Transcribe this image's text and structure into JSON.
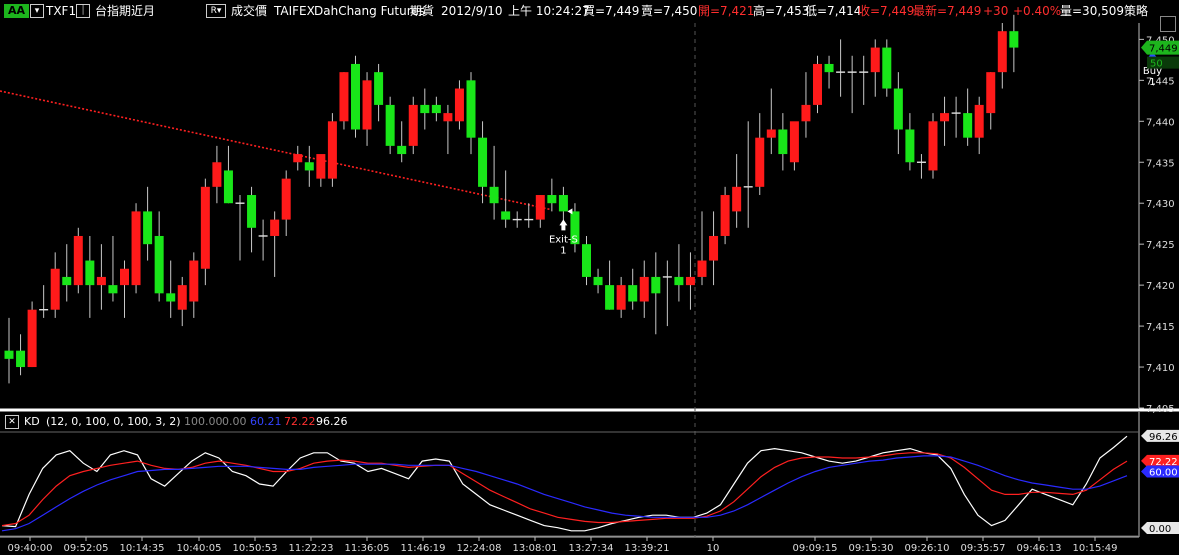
{
  "header": {
    "aa_label": "AA",
    "symbol": "TXF1",
    "symbol_name": "台指期近月",
    "mode_label": "成交價",
    "exchange": "TAIFEX",
    "broker": "DahChang Futures",
    "market": "期貨",
    "date": "2012/9/10",
    "time": "上午 10:24:27",
    "bid": "買=7,449",
    "ask": "賣=7,450",
    "open": "開=7,421",
    "high": "高=7,453",
    "low": "低=7,414",
    "close": "收=7,449",
    "last": "最新=7,449",
    "change": "+30",
    "change_pct": "+0.40%",
    "volume": "量=30,509",
    "strategy": "策略"
  },
  "colors": {
    "up": "#ff1a1a",
    "down": "#19e619",
    "k_line": "#ffffff",
    "d_line_red": "#ff2020",
    "d_line_blue": "#2a2aff",
    "trend_line": "#ff2020",
    "accent_green": "#1db51d"
  },
  "kd_panel": {
    "label": "KD",
    "params": "(12, 0, 100, 0, 100, 3, 2)",
    "v1": "100.00",
    "v2": "0.00",
    "v3": "60.21",
    "v4": "72.22",
    "v5": "96.26",
    "axis_labels": [
      "96.26",
      "72.22",
      "60.00",
      "0.00"
    ]
  },
  "chart_data": [
    {
      "type": "candlestick",
      "ylim": [
        7405,
        7452
      ],
      "y_ticks": [
        "7,450",
        "7,445",
        "7,440",
        "7,435",
        "7,430",
        "7,425",
        "7,420",
        "7,415",
        "7,410",
        "7,405"
      ],
      "last_price_label": "7,449",
      "last_volume_label": "50",
      "x_tick_labels": [
        "09:40:00",
        "09:52:05",
        "10:14:35",
        "10:40:05",
        "10:50:53",
        "11:22:23",
        "11:36:05",
        "11:46:19",
        "12:24:08",
        "13:08:01",
        "13:27:34",
        "13:39:21",
        "10",
        "09:09:15",
        "09:15:30",
        "09:26:10",
        "09:35:57",
        "09:46:13",
        "10:15:49"
      ],
      "trend_line": {
        "from": [
          0,
          7443.7
        ],
        "to": [
          47,
          7429.2
        ]
      },
      "signals": [
        {
          "label": "Exit-S",
          "qty": "1",
          "bar": 48,
          "price": 7429
        },
        {
          "label": "Buy",
          "qty": "1",
          "bar": 99,
          "price": 7447
        }
      ],
      "bars": [
        {
          "o": 7412,
          "h": 7416,
          "l": 7408,
          "c": 7411
        },
        {
          "o": 7412,
          "h": 7414,
          "l": 7409,
          "c": 7410
        },
        {
          "o": 7410,
          "h": 7418,
          "l": 7410,
          "c": 7417
        },
        {
          "o": 7417,
          "h": 7420,
          "l": 7416,
          "c": 7417
        },
        {
          "o": 7417,
          "h": 7424,
          "l": 7416,
          "c": 7422
        },
        {
          "o": 7421,
          "h": 7425,
          "l": 7418,
          "c": 7420
        },
        {
          "o": 7420,
          "h": 7427,
          "l": 7419,
          "c": 7426
        },
        {
          "o": 7423,
          "h": 7426,
          "l": 7416,
          "c": 7420
        },
        {
          "o": 7420,
          "h": 7425,
          "l": 7417,
          "c": 7421
        },
        {
          "o": 7420,
          "h": 7426,
          "l": 7418,
          "c": 7419
        },
        {
          "o": 7420,
          "h": 7423,
          "l": 7416,
          "c": 7422
        },
        {
          "o": 7420,
          "h": 7430,
          "l": 7419,
          "c": 7429
        },
        {
          "o": 7429,
          "h": 7432,
          "l": 7423,
          "c": 7425
        },
        {
          "o": 7426,
          "h": 7429,
          "l": 7418,
          "c": 7419
        },
        {
          "o": 7419,
          "h": 7423,
          "l": 7416,
          "c": 7418
        },
        {
          "o": 7417,
          "h": 7421,
          "l": 7415,
          "c": 7420
        },
        {
          "o": 7418,
          "h": 7424,
          "l": 7416,
          "c": 7423
        },
        {
          "o": 7422,
          "h": 7433,
          "l": 7420,
          "c": 7432
        },
        {
          "o": 7432,
          "h": 7437,
          "l": 7430,
          "c": 7435
        },
        {
          "o": 7434,
          "h": 7437,
          "l": 7430,
          "c": 7430
        },
        {
          "o": 7430,
          "h": 7431,
          "l": 7423,
          "c": 7430
        },
        {
          "o": 7431,
          "h": 7432,
          "l": 7424,
          "c": 7427
        },
        {
          "o": 7426,
          "h": 7428,
          "l": 7423,
          "c": 7426
        },
        {
          "o": 7426,
          "h": 7429,
          "l": 7421,
          "c": 7428
        },
        {
          "o": 7428,
          "h": 7434,
          "l": 7426,
          "c": 7433
        },
        {
          "o": 7435,
          "h": 7437,
          "l": 7434,
          "c": 7436
        },
        {
          "o": 7435,
          "h": 7437,
          "l": 7432,
          "c": 7434
        },
        {
          "o": 7433,
          "h": 7435,
          "l": 7432,
          "c": 7436
        },
        {
          "o": 7433,
          "h": 7441,
          "l": 7432,
          "c": 7440
        },
        {
          "o": 7440,
          "h": 7446,
          "l": 7439,
          "c": 7446
        },
        {
          "o": 7447,
          "h": 7448,
          "l": 7438,
          "c": 7439
        },
        {
          "o": 7439,
          "h": 7446,
          "l": 7437,
          "c": 7445
        },
        {
          "o": 7446,
          "h": 7447,
          "l": 7440,
          "c": 7442
        },
        {
          "o": 7442,
          "h": 7443,
          "l": 7436,
          "c": 7437
        },
        {
          "o": 7437,
          "h": 7440,
          "l": 7435,
          "c": 7436
        },
        {
          "o": 7437,
          "h": 7443,
          "l": 7436,
          "c": 7442
        },
        {
          "o": 7442,
          "h": 7444,
          "l": 7439,
          "c": 7441
        },
        {
          "o": 7442,
          "h": 7443,
          "l": 7440,
          "c": 7441
        },
        {
          "o": 7440,
          "h": 7442,
          "l": 7436,
          "c": 7441
        },
        {
          "o": 7440,
          "h": 7445,
          "l": 7439,
          "c": 7444
        },
        {
          "o": 7445,
          "h": 7446,
          "l": 7436,
          "c": 7438
        },
        {
          "o": 7438,
          "h": 7440,
          "l": 7430,
          "c": 7432
        },
        {
          "o": 7432,
          "h": 7437,
          "l": 7428,
          "c": 7430
        },
        {
          "o": 7429,
          "h": 7434,
          "l": 7427,
          "c": 7428
        },
        {
          "o": 7428,
          "h": 7429,
          "l": 7427,
          "c": 7428
        },
        {
          "o": 7428,
          "h": 7430,
          "l": 7427,
          "c": 7428
        },
        {
          "o": 7428,
          "h": 7431,
          "l": 7427,
          "c": 7431
        },
        {
          "o": 7431,
          "h": 7433,
          "l": 7429,
          "c": 7430
        },
        {
          "o": 7431,
          "h": 7432,
          "l": 7427,
          "c": 7429
        },
        {
          "o": 7429,
          "h": 7430,
          "l": 7424,
          "c": 7425
        },
        {
          "o": 7425,
          "h": 7426,
          "l": 7420,
          "c": 7421
        },
        {
          "o": 7421,
          "h": 7422,
          "l": 7419,
          "c": 7420
        },
        {
          "o": 7420,
          "h": 7423,
          "l": 7417,
          "c": 7417
        },
        {
          "o": 7417,
          "h": 7421,
          "l": 7416,
          "c": 7420
        },
        {
          "o": 7420,
          "h": 7422,
          "l": 7417,
          "c": 7418
        },
        {
          "o": 7418,
          "h": 7423,
          "l": 7416,
          "c": 7421
        },
        {
          "o": 7421,
          "h": 7424,
          "l": 7414,
          "c": 7419
        },
        {
          "o": 7421,
          "h": 7423,
          "l": 7415,
          "c": 7421
        },
        {
          "o": 7421,
          "h": 7425,
          "l": 7418,
          "c": 7420
        },
        {
          "o": 7420,
          "h": 7424,
          "l": 7417,
          "c": 7421
        },
        {
          "o": 7421,
          "h": 7429,
          "l": 7420,
          "c": 7423
        },
        {
          "o": 7423,
          "h": 7429,
          "l": 7420,
          "c": 7426
        },
        {
          "o": 7426,
          "h": 7432,
          "l": 7425,
          "c": 7431
        },
        {
          "o": 7429,
          "h": 7436,
          "l": 7427,
          "c": 7432
        },
        {
          "o": 7432,
          "h": 7440,
          "l": 7427,
          "c": 7432
        },
        {
          "o": 7432,
          "h": 7441,
          "l": 7431,
          "c": 7438
        },
        {
          "o": 7438,
          "h": 7444,
          "l": 7436,
          "c": 7439
        },
        {
          "o": 7439,
          "h": 7441,
          "l": 7434,
          "c": 7436
        },
        {
          "o": 7435,
          "h": 7439,
          "l": 7434,
          "c": 7440
        },
        {
          "o": 7440,
          "h": 7446,
          "l": 7438,
          "c": 7442
        },
        {
          "o": 7442,
          "h": 7448,
          "l": 7441,
          "c": 7447
        },
        {
          "o": 7447,
          "h": 7448,
          "l": 7444,
          "c": 7446
        },
        {
          "o": 7446,
          "h": 7450,
          "l": 7443,
          "c": 7446
        },
        {
          "o": 7446,
          "h": 7448,
          "l": 7441,
          "c": 7446
        },
        {
          "o": 7446,
          "h": 7448,
          "l": 7442,
          "c": 7446
        },
        {
          "o": 7446,
          "h": 7450,
          "l": 7443,
          "c": 7449
        },
        {
          "o": 7449,
          "h": 7450,
          "l": 7443,
          "c": 7444
        },
        {
          "o": 7444,
          "h": 7446,
          "l": 7436,
          "c": 7439
        },
        {
          "o": 7439,
          "h": 7441,
          "l": 7434,
          "c": 7435
        },
        {
          "o": 7435,
          "h": 7436,
          "l": 7433,
          "c": 7435
        },
        {
          "o": 7434,
          "h": 7441,
          "l": 7433,
          "c": 7440
        },
        {
          "o": 7440,
          "h": 7443,
          "l": 7437,
          "c": 7441
        },
        {
          "o": 7441,
          "h": 7443,
          "l": 7438,
          "c": 7441
        },
        {
          "o": 7441,
          "h": 7444,
          "l": 7437,
          "c": 7438
        },
        {
          "o": 7438,
          "h": 7443,
          "l": 7436,
          "c": 7442
        },
        {
          "o": 7441,
          "h": 7446,
          "l": 7439,
          "c": 7446
        },
        {
          "o": 7446,
          "h": 7452,
          "l": 7444,
          "c": 7451
        },
        {
          "o": 7451,
          "h": 7453,
          "l": 7446,
          "c": 7449
        }
      ]
    },
    {
      "type": "line",
      "ylim": [
        0,
        100
      ],
      "series": [
        {
          "values": [
            10,
            9,
            40,
            65,
            78,
            82,
            70,
            62,
            78,
            82,
            78,
            55,
            48,
            60,
            72,
            80,
            75,
            62,
            58,
            50,
            48,
            62,
            75,
            80,
            80,
            72,
            70,
            62,
            65,
            60,
            55,
            72,
            74,
            72,
            50,
            40,
            30,
            25,
            20,
            15,
            10,
            8,
            5,
            5,
            8,
            12,
            15,
            18,
            20,
            20,
            18,
            18,
            22,
            30,
            50,
            70,
            82,
            84,
            82,
            80,
            76,
            72,
            70,
            72,
            76,
            80,
            82,
            84,
            80,
            78,
            65,
            40,
            20,
            10,
            15,
            30,
            45,
            40,
            35,
            30,
            50,
            75,
            85,
            96
          ]
        },
        {
          "values": [
            10,
            12,
            20,
            35,
            48,
            58,
            62,
            65,
            68,
            70,
            72,
            68,
            65,
            64,
            66,
            70,
            72,
            70,
            68,
            65,
            62,
            62,
            65,
            70,
            72,
            73,
            72,
            70,
            70,
            68,
            66,
            67,
            68,
            68,
            60,
            52,
            44,
            38,
            32,
            26,
            22,
            18,
            16,
            14,
            13,
            13,
            14,
            15,
            16,
            17,
            17,
            17,
            19,
            24,
            33,
            45,
            57,
            66,
            72,
            75,
            76,
            76,
            75,
            75,
            76,
            77,
            79,
            80,
            80,
            79,
            75,
            66,
            55,
            44,
            40,
            40,
            42,
            42,
            41,
            40,
            44,
            54,
            64,
            72
          ]
        },
        {
          "values": [
            5,
            7,
            12,
            20,
            28,
            36,
            43,
            49,
            54,
            58,
            62,
            63,
            64,
            64,
            65,
            66,
            67,
            67,
            67,
            66,
            65,
            64,
            64,
            66,
            67,
            68,
            69,
            69,
            69,
            69,
            68,
            68,
            68,
            68,
            65,
            62,
            58,
            54,
            50,
            45,
            40,
            36,
            32,
            28,
            25,
            22,
            20,
            19,
            18,
            18,
            18,
            18,
            18,
            20,
            24,
            30,
            37,
            44,
            51,
            57,
            62,
            66,
            68,
            70,
            72,
            73,
            75,
            76,
            77,
            77,
            76,
            72,
            68,
            63,
            58,
            54,
            51,
            49,
            47,
            45,
            45,
            48,
            53,
            58
          ]
        }
      ]
    }
  ]
}
